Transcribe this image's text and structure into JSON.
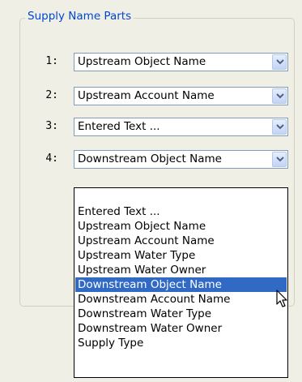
{
  "group": {
    "title": "Supply Name Parts"
  },
  "rows": [
    {
      "number": "1:",
      "value": "Upstream Object Name"
    },
    {
      "number": "2:",
      "value": "Upstream Account Name"
    },
    {
      "number": "3:",
      "value": "Entered Text ..."
    },
    {
      "number": "4:",
      "value": "Downstream Object Name"
    }
  ],
  "dropdown": {
    "options": [
      "",
      "Entered Text ...",
      "Upstream Object Name",
      "Upstream Account Name",
      "Upstream Water Type",
      "Upstream Water Owner",
      "Downstream Object Name",
      "Downstream Account Name",
      "Downstream Water Type",
      "Downstream Water Owner",
      "Supply Type"
    ],
    "selected": "Downstream Object Name"
  },
  "icons": {
    "combo_button": "chevron-down-icon",
    "cursor": "mouse-pointer-icon"
  },
  "colors": {
    "group_title": "#0046d5",
    "selection": "#316ac5",
    "combo_border": "#7f9db9"
  }
}
